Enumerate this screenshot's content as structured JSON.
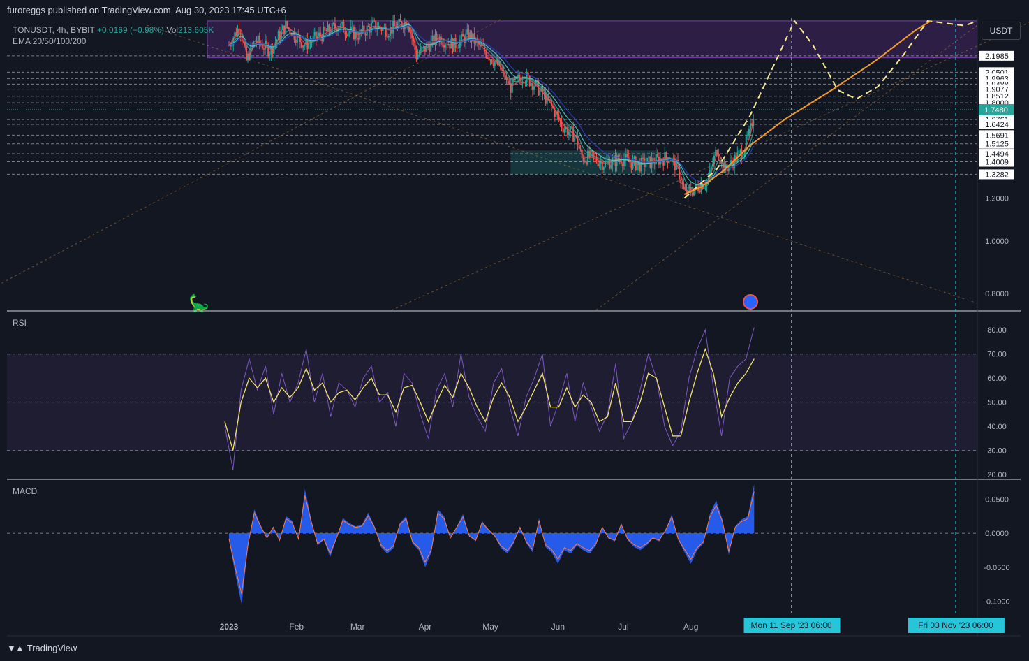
{
  "header": {
    "published": "furoreggs published on TradingView.com, Aug 30, 2023 17:45 UTC+6"
  },
  "legend": {
    "symbol": "TONUSDT, 4h, BYBIT",
    "change": "+0.0169 (+0.98%)",
    "vol_label": "Vol",
    "vol_value": "213.605K",
    "ema_label": "EMA 20/50/100/200",
    "rsi_label": "RSI",
    "macd_label": "MACD"
  },
  "currency_button": "USDT",
  "brand": "TradingView",
  "colors": {
    "background": "#131722",
    "up": "#26a69a",
    "down": "#ef5350",
    "rsi": "#7e57c2",
    "rsi_signal": "#f5e56b",
    "macd_hist": "#2962ff",
    "macd_signal": "#ff7a3d",
    "projection": "#f7e98e",
    "curve": "#f59b23",
    "zone": "#5b2a86",
    "cyan_line": "#22b5d6"
  },
  "chart_data": [
    {
      "type": "candlestick",
      "title": "TONUSDT, 4h, BYBIT",
      "x_tick_labels": [
        "2023",
        "Feb",
        "Mar",
        "Apr",
        "May",
        "Jun",
        "Jul",
        "Aug"
      ],
      "x_range": [
        "2023-01-01",
        "2023-11-10"
      ],
      "y_scale": "log",
      "y_ticks": [
        0.8,
        1.0,
        1.2
      ],
      "y_tick_labels": [
        "1.2000",
        "1.0000",
        "0.8000"
      ],
      "last_price": 1.748,
      "last_price_label": "1.7480",
      "level_labels": [
        "2.1985",
        "2.0501",
        "1.9963",
        "1.9488",
        "1.9077",
        "1.8512",
        "1.8000",
        "1.6761",
        "1.6424",
        "1.5691",
        "1.5125",
        "1.4494",
        "1.4009",
        "1.3282"
      ],
      "levels": [
        2.1985,
        2.0501,
        1.9963,
        1.9488,
        1.9077,
        1.8512,
        1.8,
        1.6761,
        1.6424,
        1.5691,
        1.5125,
        1.4494,
        1.4009,
        1.3282
      ],
      "close_path": [
        [
          "2023-01-01",
          2.3
        ],
        [
          "2023-01-06",
          2.5
        ],
        [
          "2023-01-09",
          2.15
        ],
        [
          "2023-01-13",
          2.35
        ],
        [
          "2023-01-20",
          2.25
        ],
        [
          "2023-01-27",
          2.5
        ],
        [
          "2023-02-05",
          2.3
        ],
        [
          "2023-02-12",
          2.4
        ],
        [
          "2023-02-20",
          2.5
        ],
        [
          "2023-03-01",
          2.4
        ],
        [
          "2023-03-08",
          2.5
        ],
        [
          "2023-03-15",
          2.45
        ],
        [
          "2023-03-24",
          2.55
        ],
        [
          "2023-03-28",
          2.2
        ],
        [
          "2023-03-31",
          2.25
        ],
        [
          "2023-04-07",
          2.38
        ],
        [
          "2023-04-14",
          2.3
        ],
        [
          "2023-04-21",
          2.4
        ],
        [
          "2023-04-28",
          2.25
        ],
        [
          "2023-05-05",
          2.1
        ],
        [
          "2023-05-10",
          1.92
        ],
        [
          "2023-05-16",
          2.02
        ],
        [
          "2023-05-21",
          1.95
        ],
        [
          "2023-05-28",
          1.8
        ],
        [
          "2023-06-03",
          1.63
        ],
        [
          "2023-06-09",
          1.56
        ],
        [
          "2023-06-12",
          1.42
        ],
        [
          "2023-06-16",
          1.43
        ],
        [
          "2023-06-22",
          1.39
        ],
        [
          "2023-06-30",
          1.42
        ],
        [
          "2023-07-08",
          1.38
        ],
        [
          "2023-07-16",
          1.41
        ],
        [
          "2023-07-22",
          1.43
        ],
        [
          "2023-07-26",
          1.36
        ],
        [
          "2023-07-29",
          1.22
        ],
        [
          "2023-08-03",
          1.25
        ],
        [
          "2023-08-09",
          1.3
        ],
        [
          "2023-08-13",
          1.48
        ],
        [
          "2023-08-16",
          1.35
        ],
        [
          "2023-08-20",
          1.4
        ],
        [
          "2023-08-25",
          1.47
        ],
        [
          "2023-08-28",
          1.58
        ],
        [
          "2023-08-30",
          1.748
        ]
      ],
      "purple_zone": {
        "from": "2023-01-01",
        "to": "2023-11-10",
        "low": 2.18,
        "high": 2.55
      },
      "green_zone": {
        "from": "2023-06-12",
        "to": "2023-07-29",
        "low": 1.33,
        "high": 1.47
      },
      "projection_path": [
        [
          "2023-07-29",
          1.2
        ],
        [
          "2023-08-13",
          1.36
        ],
        [
          "2023-08-28",
          1.7
        ],
        [
          "2023-09-06",
          2.15
        ],
        [
          "2023-09-12",
          2.55
        ],
        [
          "2023-09-18",
          2.3
        ],
        [
          "2023-09-26",
          1.9
        ],
        [
          "2023-10-02",
          1.83
        ],
        [
          "2023-10-09",
          1.93
        ],
        [
          "2023-10-17",
          2.2
        ],
        [
          "2023-10-25",
          2.55
        ],
        [
          "2023-11-06",
          2.5
        ],
        [
          "2023-11-10",
          2.55
        ]
      ],
      "curve_path": [
        [
          "2023-07-29",
          1.22
        ],
        [
          "2023-08-06",
          1.26
        ],
        [
          "2023-08-16",
          1.35
        ],
        [
          "2023-08-28",
          1.5
        ],
        [
          "2023-09-09",
          1.68
        ],
        [
          "2023-09-24",
          1.9
        ],
        [
          "2023-10-08",
          2.15
        ],
        [
          "2023-10-21",
          2.45
        ],
        [
          "2023-10-26",
          2.55
        ]
      ]
    },
    {
      "type": "line",
      "title": "RSI",
      "y_ticks": [
        20,
        30,
        40,
        50,
        60,
        70,
        80
      ],
      "y_tick_labels": [
        "80.00",
        "70.00",
        "60.00",
        "50.00",
        "40.00",
        "30.00",
        "20.00"
      ],
      "ylim": [
        18,
        85
      ],
      "bands": [
        30,
        50,
        70
      ],
      "series": [
        {
          "values": [
            40,
            22,
            55,
            68,
            55,
            65,
            45,
            62,
            50,
            58,
            72,
            50,
            62,
            44,
            58,
            55,
            48,
            60,
            65,
            50,
            54,
            40,
            62,
            58,
            45,
            35,
            55,
            62,
            48,
            70,
            52,
            44,
            38,
            58,
            64,
            48,
            36,
            52,
            60,
            70,
            40,
            50,
            62,
            42,
            58,
            48,
            38,
            45,
            66,
            35,
            42,
            55,
            70,
            60,
            40,
            32,
            38,
            60,
            72,
            80,
            56,
            36,
            60,
            65,
            68,
            81
          ]
        },
        {
          "values": [
            42,
            30,
            50,
            60,
            56,
            60,
            50,
            56,
            52,
            56,
            64,
            55,
            58,
            50,
            54,
            55,
            51,
            56,
            60,
            53,
            53,
            46,
            56,
            57,
            50,
            42,
            50,
            57,
            52,
            62,
            56,
            48,
            42,
            52,
            58,
            52,
            42,
            48,
            55,
            62,
            48,
            48,
            56,
            48,
            53,
            50,
            42,
            44,
            58,
            42,
            42,
            50,
            62,
            60,
            48,
            36,
            36,
            50,
            62,
            72,
            62,
            44,
            52,
            58,
            62,
            68
          ]
        }
      ]
    },
    {
      "type": "bar",
      "title": "MACD",
      "y_ticks": [
        -0.1,
        -0.05,
        0,
        0.05
      ],
      "y_tick_labels": [
        "0.0500",
        "0.0000",
        "-0.0500",
        "-0.1000"
      ],
      "ylim": [
        -0.12,
        0.075
      ],
      "values": [
        -0.01,
        -0.06,
        -0.105,
        -0.02,
        0.035,
        0.012,
        -0.008,
        0.01,
        -0.012,
        0.025,
        0.018,
        -0.01,
        0.065,
        0.02,
        -0.018,
        -0.01,
        -0.035,
        -0.008,
        0.022,
        0.015,
        0.01,
        0.012,
        0.03,
        0.01,
        -0.02,
        -0.03,
        -0.022,
        0.015,
        0.025,
        -0.015,
        -0.025,
        -0.05,
        -0.028,
        0.035,
        0.025,
        -0.008,
        0.01,
        0.028,
        -0.005,
        -0.012,
        0.018,
        0.006,
        -0.005,
        -0.022,
        -0.03,
        -0.015,
        0.01,
        -0.015,
        -0.028,
        0.022,
        -0.02,
        -0.028,
        -0.045,
        -0.025,
        -0.03,
        -0.018,
        -0.025,
        -0.03,
        -0.018,
        0.01,
        -0.008,
        -0.012,
        0.015,
        -0.01,
        -0.02,
        -0.025,
        -0.018,
        -0.008,
        -0.012,
        0.005,
        0.028,
        -0.01,
        -0.028,
        -0.045,
        -0.025,
        -0.015,
        0.028,
        0.048,
        0.02,
        -0.032,
        0.01,
        0.02,
        0.025,
        0.072
      ]
    }
  ],
  "time_markers": [
    {
      "date": "2023-09-11",
      "label": "Mon 11 Sep '23   06:00"
    },
    {
      "date": "2023-11-03",
      "label": "Fri 03 Nov '23   06:00"
    }
  ]
}
